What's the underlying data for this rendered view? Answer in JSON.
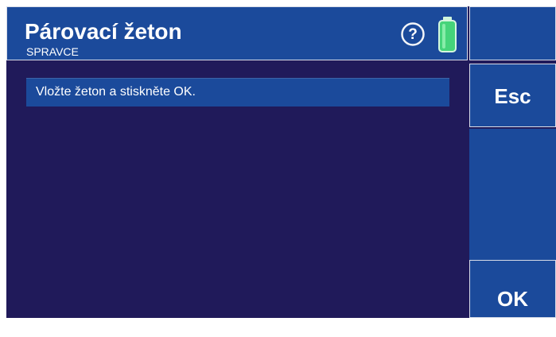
{
  "header": {
    "title": "Párovací žeton",
    "subtitle": "SPRAVCE"
  },
  "main": {
    "message": "Vložte žeton a stiskněte OK."
  },
  "side_buttons": {
    "esc_label": "Esc",
    "ok_label": "OK"
  },
  "icons": {
    "help": "help-icon",
    "battery": "battery-icon"
  },
  "colors": {
    "background": "#201a5a",
    "panel": "#1b4a9b",
    "border": "#d8dce8",
    "battery": "#45d47a"
  }
}
